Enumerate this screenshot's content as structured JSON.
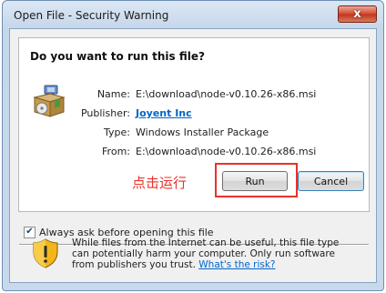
{
  "window": {
    "title": "Open File - Security Warning",
    "close_label": "x"
  },
  "dialog": {
    "heading": "Do you want to run this file?",
    "fields": {
      "name_label": "Name:",
      "name_value": "E:\\download\\node-v0.10.26-x86.msi",
      "publisher_label": "Publisher:",
      "publisher_value": "Joyent Inc",
      "type_label": "Type:",
      "type_value": "Windows Installer Package",
      "from_label": "From:",
      "from_value": "E:\\download\\node-v0.10.26-x86.msi"
    },
    "annotation": "点击运行",
    "run_label": "Run",
    "cancel_label": "Cancel",
    "checkbox": {
      "label": "Always ask before opening this file",
      "checked": true,
      "mark": "✔"
    },
    "warning": {
      "text": "While files from the Internet can be useful, this file type can potentially harm your computer. Only run software from publishers you trust.",
      "link": "What's the risk?"
    }
  },
  "colors": {
    "annotation": "#e8322a",
    "link": "#0066cc",
    "close_button": "#c13419"
  },
  "icons": {
    "file": "installer-package-icon",
    "warning": "shield-warning-icon",
    "close": "close-icon"
  }
}
